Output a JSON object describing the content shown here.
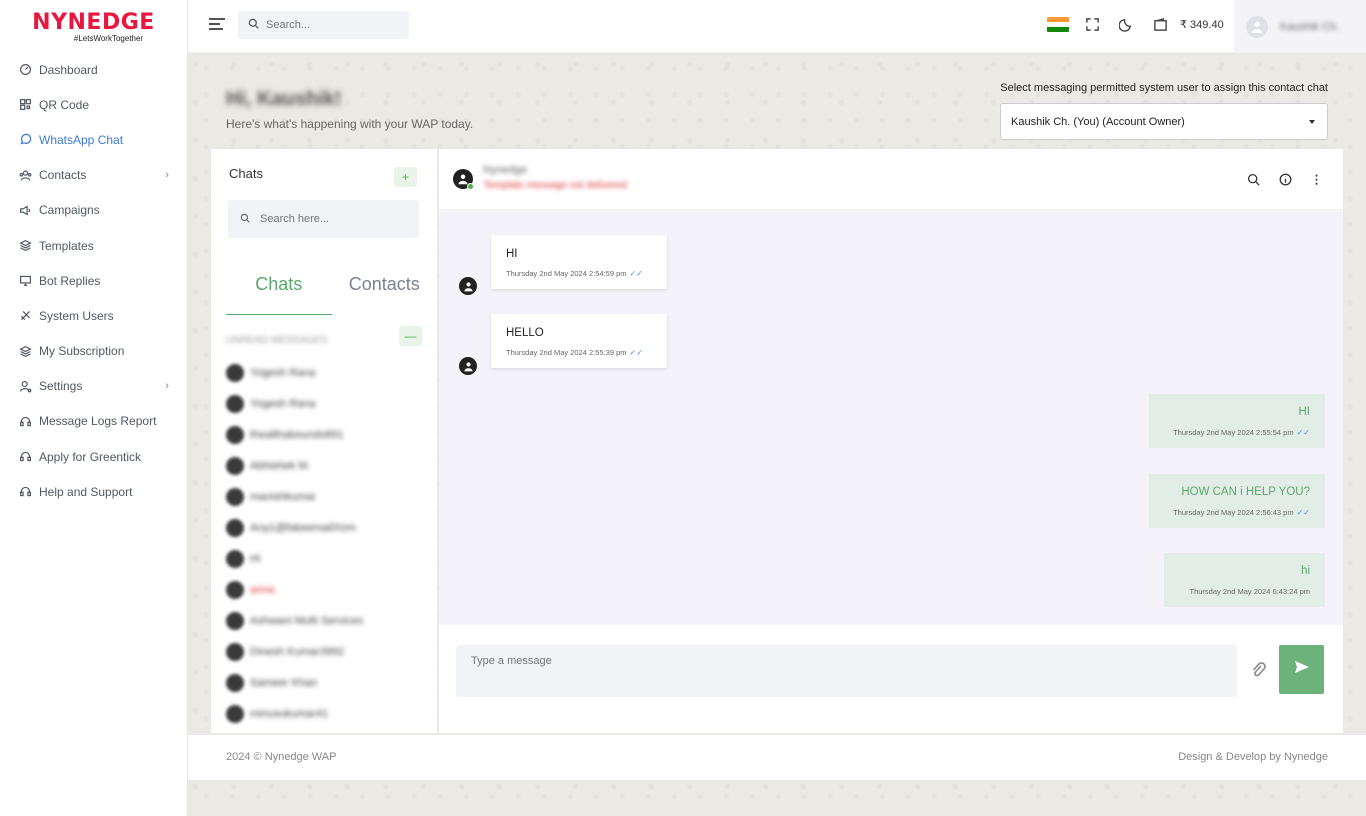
{
  "brand": {
    "name": "NYNEDGE",
    "tagline": "#LetsWorkTogether"
  },
  "sidebar": {
    "items": [
      {
        "label": "Dashboard",
        "icon": "dashboard-icon",
        "active": false,
        "chevron": false
      },
      {
        "label": "QR Code",
        "icon": "qr-code-icon",
        "active": false,
        "chevron": false
      },
      {
        "label": "WhatsApp Chat",
        "icon": "chat-bubble-icon",
        "active": true,
        "chevron": false
      },
      {
        "label": "Contacts",
        "icon": "contacts-icon",
        "active": false,
        "chevron": true
      },
      {
        "label": "Campaigns",
        "icon": "megaphone-icon",
        "active": false,
        "chevron": false
      },
      {
        "label": "Templates",
        "icon": "layers-icon",
        "active": false,
        "chevron": false
      },
      {
        "label": "Bot Replies",
        "icon": "monitor-icon",
        "active": false,
        "chevron": false
      },
      {
        "label": "System Users",
        "icon": "users-icon",
        "active": false,
        "chevron": false
      },
      {
        "label": "My Subscription",
        "icon": "layers-icon",
        "active": false,
        "chevron": false
      },
      {
        "label": "Settings",
        "icon": "settings-user-icon",
        "active": false,
        "chevron": true
      },
      {
        "label": "Message Logs Report",
        "icon": "headset-icon",
        "active": false,
        "chevron": false
      },
      {
        "label": "Apply for Greentick",
        "icon": "headset-icon",
        "active": false,
        "chevron": false
      },
      {
        "label": "Help and Support",
        "icon": "headset-icon",
        "active": false,
        "chevron": false
      }
    ]
  },
  "topbar": {
    "search_placeholder": "Search...",
    "balance": "₹ 349.40",
    "user_name": "Kaushik Ch.",
    "flag_colors": [
      "#ff9933",
      "#ffffff",
      "#138808"
    ]
  },
  "page": {
    "greeting": "Hi, Kaushik!",
    "subtitle": "Here's what's happening with your WAP today.",
    "assign_label": "Select messaging permitted system user to assign this contact chat",
    "assign_selected": "Kaushik Ch. (You) (Account Owner)"
  },
  "chatlist": {
    "title": "Chats",
    "add_label": "+",
    "search_placeholder": "Search here...",
    "tabs": [
      "Chats",
      "Contacts"
    ],
    "section_label": "UNREAD MESSAGES",
    "collapse_label": "—",
    "items": [
      {
        "name": "Yogesh Rana",
        "red": false
      },
      {
        "name": "Yogesh Rana",
        "red": false
      },
      {
        "name": "thealthabounds891",
        "red": false
      },
      {
        "name": "Abhishek M.",
        "red": false
      },
      {
        "name": "manishkumar",
        "red": false
      },
      {
        "name": "Any1@fakeemailXom",
        "red": false
      },
      {
        "name": "Hi",
        "red": false
      },
      {
        "name": "anna",
        "red": true
      },
      {
        "name": "Ashwani Multi Services",
        "red": false
      },
      {
        "name": "Dinesh Kumar3992",
        "red": false
      },
      {
        "name": "Sameer Khan",
        "red": false
      },
      {
        "name": "minusukumar41",
        "red": false
      }
    ]
  },
  "chat": {
    "contact_name": "Nynedge",
    "contact_status": "Template message not delivered",
    "incoming": [
      {
        "text": "HI",
        "time": "Thursday 2nd May 2024 2:54:59 pm"
      },
      {
        "text": "HELLO",
        "time": "Thursday 2nd May 2024 2:55:39 pm"
      }
    ],
    "outgoing": [
      {
        "text": "HI",
        "time": "Thursday 2nd May 2024 2:55:54 pm"
      },
      {
        "text": "HOW CAN i HELP YOU?",
        "time": "Thursday 2nd May 2024 2:56:43 pm"
      },
      {
        "text": "hi",
        "time": "Thursday 2nd May 2024 6:43:24 pm"
      }
    ],
    "input_placeholder": "Type a message"
  },
  "footer": {
    "copyright": "2024 © Nynedge WAP",
    "credit": "Design & Develop by Nynedge"
  },
  "colors": {
    "accent_green": "#5ba86a",
    "active_blue": "#3a7bd5",
    "brand_red": "#e8173f"
  }
}
